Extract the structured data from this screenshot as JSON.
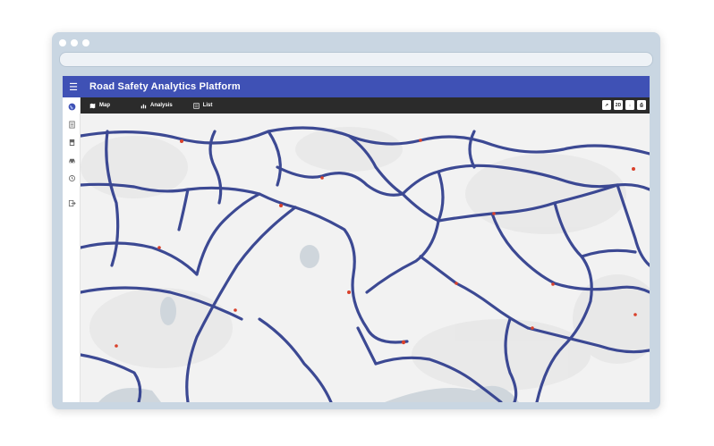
{
  "app": {
    "title": "Road Safety Analytics Platform",
    "header_color": "#3f51b5",
    "toolbar_color": "#2b2b2b"
  },
  "sidebar": {
    "items": [
      {
        "name": "globe",
        "icon": "globe-icon"
      },
      {
        "name": "reports",
        "icon": "document-icon"
      },
      {
        "name": "documents",
        "icon": "file-icon"
      },
      {
        "name": "vehicles",
        "icon": "car-icon"
      },
      {
        "name": "history",
        "icon": "history-icon"
      },
      {
        "name": "logout",
        "icon": "exit-icon"
      }
    ]
  },
  "toolbar": {
    "tabs": [
      {
        "label": "Map",
        "icon": "map-icon"
      },
      {
        "label": "Analysis",
        "icon": "bar-chart-icon"
      },
      {
        "label": "List",
        "icon": "list-icon"
      }
    ],
    "buttons": [
      {
        "label": "↗",
        "icon": "route-icon"
      },
      {
        "label": "2D",
        "icon": "2d-toggle-icon"
      },
      {
        "label": "↓",
        "icon": "download-icon"
      },
      {
        "label": "⎙",
        "icon": "print-icon"
      }
    ]
  },
  "map": {
    "road_color": "#2d3b8c",
    "incident_color": "#d9412b",
    "land_color": "#f2f2f2",
    "water_color": "#cfd6dc"
  }
}
